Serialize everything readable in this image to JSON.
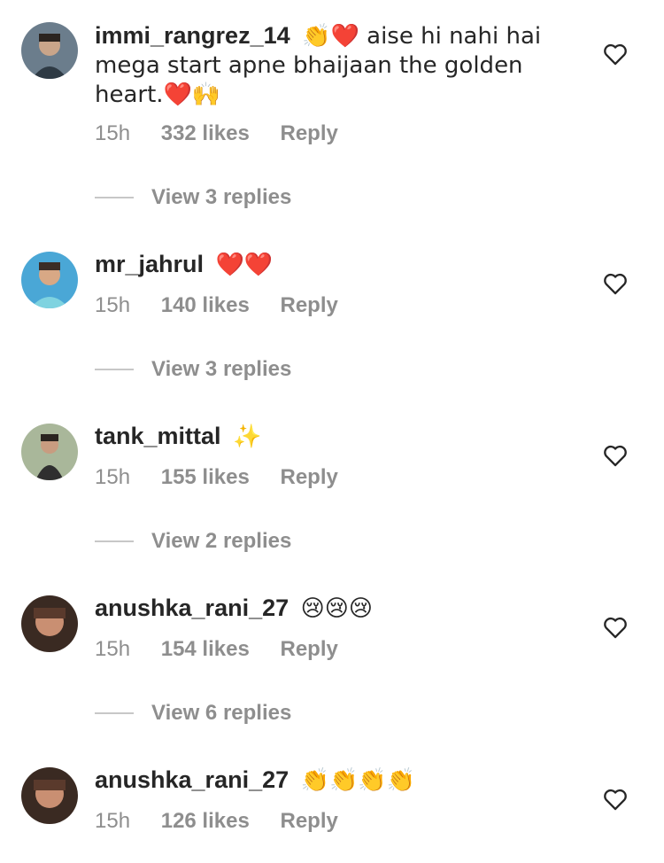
{
  "comments": [
    {
      "username": "immi_rangrez_14",
      "text": "👏❤️ aise hi nahi hai mega start apne bhaijaan the golden heart.❤️🙌",
      "time": "15h",
      "likes": "332 likes",
      "reply": "Reply",
      "view_replies": "View 3 replies"
    },
    {
      "username": "mr_jahrul",
      "text": "❤️❤️",
      "time": "15h",
      "likes": "140 likes",
      "reply": "Reply",
      "view_replies": "View 3 replies"
    },
    {
      "username": "tank_mittal",
      "text": "✨",
      "time": "15h",
      "likes": "155 likes",
      "reply": "Reply",
      "view_replies": "View 2 replies"
    },
    {
      "username": "anushka_rani_27",
      "text": "😢😢😢",
      "time": "15h",
      "likes": "154 likes",
      "reply": "Reply",
      "view_replies": "View 6 replies"
    },
    {
      "username": "anushka_rani_27",
      "text": "👏👏👏👏",
      "time": "15h",
      "likes": "126 likes",
      "reply": "Reply"
    }
  ],
  "icons": {
    "like": "heart-outline-icon"
  },
  "colors": {
    "text": "#262626",
    "meta": "#8e8e8e",
    "divider": "#c7c7c7"
  }
}
